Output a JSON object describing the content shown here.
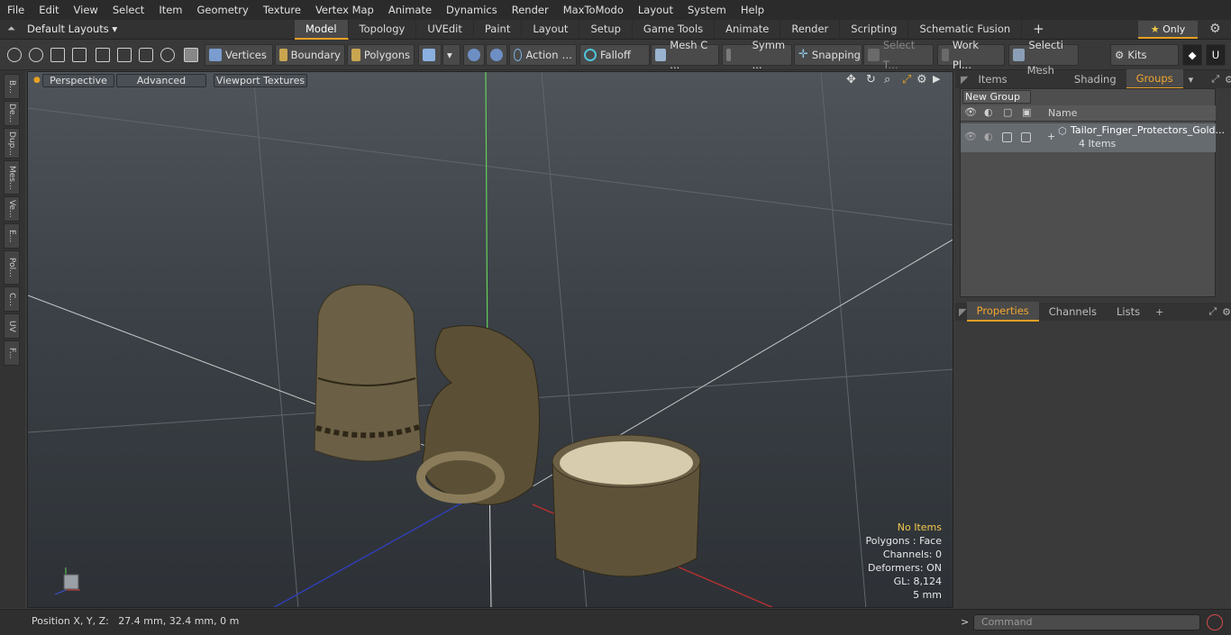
{
  "menu": [
    "File",
    "Edit",
    "View",
    "Select",
    "Item",
    "Geometry",
    "Texture",
    "Vertex Map",
    "Animate",
    "Dynamics",
    "Render",
    "MaxToModo",
    "Layout",
    "System",
    "Help"
  ],
  "layout_selector": "Default Layouts",
  "tabs": [
    "Model",
    "Topology",
    "UVEdit",
    "Paint",
    "Layout",
    "Setup",
    "Game Tools",
    "Animate",
    "Render",
    "Scripting",
    "Schematic Fusion"
  ],
  "only_label": "Only",
  "toolbar": {
    "vertices": "Vertices",
    "boundary": "Boundary",
    "polygons": "Polygons",
    "action": "Action",
    "falloff": "Falloff",
    "mesh": "Mesh C ...",
    "symm": "Symm ...",
    "snapping": "Snapping",
    "select_t": "Select T...",
    "workpl": "Work Pl...",
    "selecti": "Selecti ...",
    "kits": "Kits"
  },
  "left_tabs": [
    "B...",
    "De...",
    "Dup...",
    "Mes...",
    "Ve...",
    "E...",
    "Pol...",
    "C...",
    "UV",
    "F..."
  ],
  "viewport": {
    "perspective": "Perspective",
    "advanced": "Advanced",
    "textures": "Viewport Textures"
  },
  "info": {
    "items": "No Items",
    "polygons": "Polygons : Face",
    "channels": "Channels: 0",
    "deformers": "Deformers: ON",
    "gl": "GL: 8,124",
    "scale": "5 mm"
  },
  "status": "Position X, Y, Z:   27.4 mm, 32.4 mm, 0 m",
  "panel_tabs": [
    "Items",
    "Mesh ...",
    "Shading",
    "Groups"
  ],
  "new_group": "New Group",
  "col_name": "Name",
  "group": {
    "name": "Tailor_Finger_Protectors_Gold...",
    "count": "4 Items"
  },
  "prop_tabs": [
    "Properties",
    "Channels",
    "Lists"
  ],
  "command_placeholder": "Command",
  "colors": {
    "accent": "#e6a023",
    "gold": "#8a7a55"
  }
}
